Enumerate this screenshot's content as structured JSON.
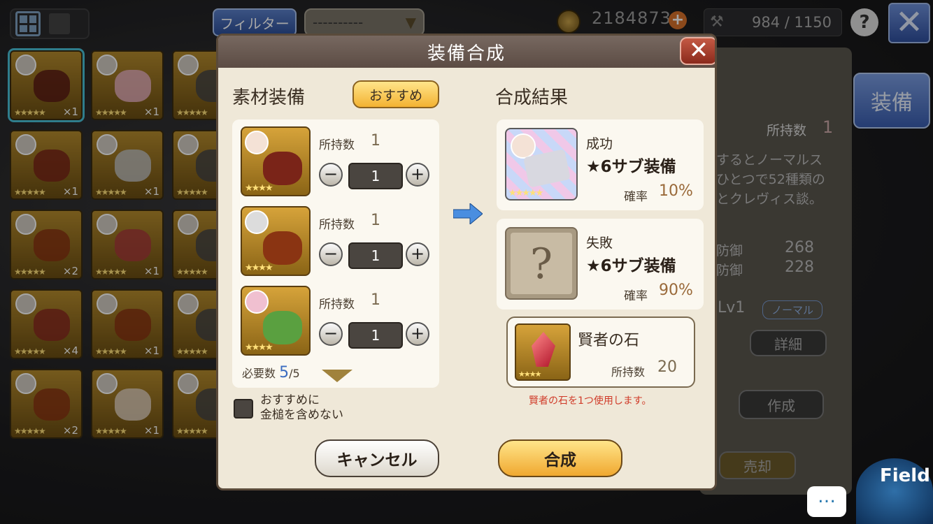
{
  "topbar": {
    "filter_label": "フィルター",
    "dropdown_value": "----------",
    "gold": "2184873",
    "stamina": "984 / 1150",
    "help": "?",
    "close": "✕"
  },
  "inventory": [
    {
      "count": "×1",
      "stars": "★★★★★"
    },
    {
      "count": "×1",
      "stars": "★★★★★"
    },
    {
      "count": "",
      "stars": "★★★★★"
    },
    {
      "count": "×1",
      "stars": "★★★★★"
    },
    {
      "count": "×1",
      "stars": "★★★★★"
    },
    {
      "count": "",
      "stars": "★★★★★"
    },
    {
      "count": "×2",
      "stars": "★★★★★"
    },
    {
      "count": "×1",
      "stars": "★★★★★"
    },
    {
      "count": "",
      "stars": "★★★★★"
    },
    {
      "count": "×4",
      "stars": "★★★★★"
    },
    {
      "count": "×1",
      "stars": "★★★★★"
    },
    {
      "count": "",
      "stars": "★★★★★"
    },
    {
      "count": "×2",
      "stars": "★★★★★"
    },
    {
      "count": "×1",
      "stars": "★★★★★"
    },
    {
      "count": "",
      "stars": "★★★★★"
    }
  ],
  "side_panel": {
    "equip_button": "装備",
    "owned_label": "所持数",
    "owned_value": "1",
    "desc_lines": [
      "するとノーマルス",
      "ひとつで52種類の",
      "とクレヴィス談。"
    ],
    "stat1_label": "防御",
    "stat1_value": "268",
    "stat2_label": "防御",
    "stat2_value": "228",
    "level": "Lv1",
    "rarity": "ノーマル",
    "detail_button": "詳細",
    "craft_button": "作成",
    "sell_button": "売却"
  },
  "field_label": "Field",
  "chat_icon": "…",
  "dialog": {
    "title": "装備合成",
    "close": "✕",
    "materials_heading": "素材装備",
    "recommend_button": "おすすめ",
    "results_heading": "合成結果",
    "materials": [
      {
        "owned_label": "所持数",
        "owned": "1",
        "qty": "1",
        "stars": "★★★★"
      },
      {
        "owned_label": "所持数",
        "owned": "1",
        "qty": "1",
        "stars": "★★★★"
      },
      {
        "owned_label": "所持数",
        "owned": "1",
        "qty": "1",
        "stars": "★★★★"
      }
    ],
    "required_label": "必要数",
    "required_current": "5",
    "required_total": "/5",
    "exclude_checkbox_label": "おすすめに\n金槌を含めない",
    "success": {
      "label": "成功",
      "item": "★6サブ装備",
      "rate_label": "確率",
      "rate": "10%",
      "stars": "★★★★★"
    },
    "failure": {
      "label": "失敗",
      "item": "★6サブ装備",
      "rate_label": "確率",
      "rate": "90%"
    },
    "stone": {
      "name": "賢者の石",
      "owned_label": "所持数",
      "owned": "20",
      "stars": "★★★★"
    },
    "stone_notice": "賢者の石を1つ使用します。",
    "cancel_button": "キャンセル",
    "confirm_button": "合成"
  }
}
